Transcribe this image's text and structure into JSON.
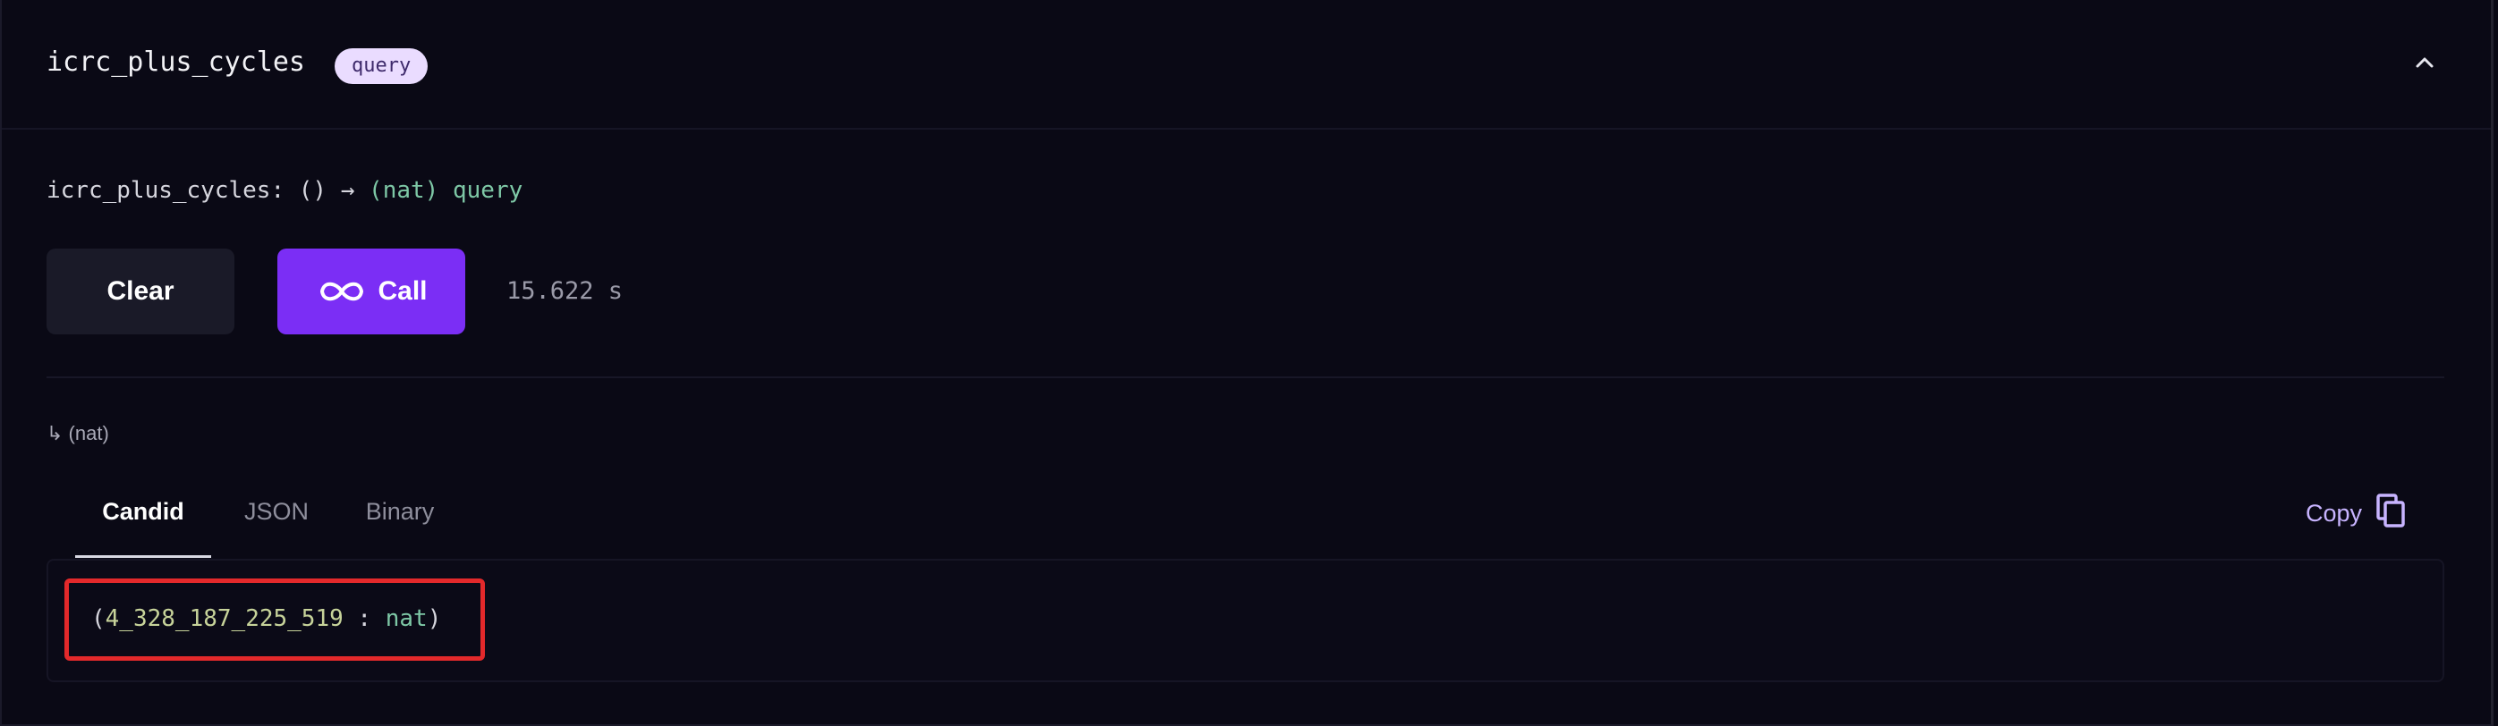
{
  "method": {
    "name": "icrc_plus_cycles",
    "badge": "query"
  },
  "signature": {
    "name": "icrc_plus_cycles:",
    "args": "()",
    "arrow": "→",
    "returns": "(nat)",
    "mode": "query"
  },
  "actions": {
    "clear_label": "Clear",
    "call_label": "Call",
    "elapsed": "15.622 s"
  },
  "result": {
    "return_type_label": "↳ (nat)",
    "tabs": [
      {
        "label": "Candid",
        "active": true
      },
      {
        "label": "JSON",
        "active": false
      },
      {
        "label": "Binary",
        "active": false
      }
    ],
    "copy_label": "Copy",
    "open_paren": "(",
    "value": "4_328_187_225_519",
    "separator": " : ",
    "type": "nat",
    "close_paren": ")"
  },
  "colors": {
    "background": "#0a0915",
    "accent": "#7b2ef5",
    "badge": "#eadcff",
    "type_green": "#7ec8a6",
    "highlight_red": "#e3292b",
    "copy_purple": "#c8b4ff"
  },
  "icons": {
    "collapse": "chevron-up-icon",
    "call": "infinity-icon",
    "copy": "copy-icon"
  }
}
